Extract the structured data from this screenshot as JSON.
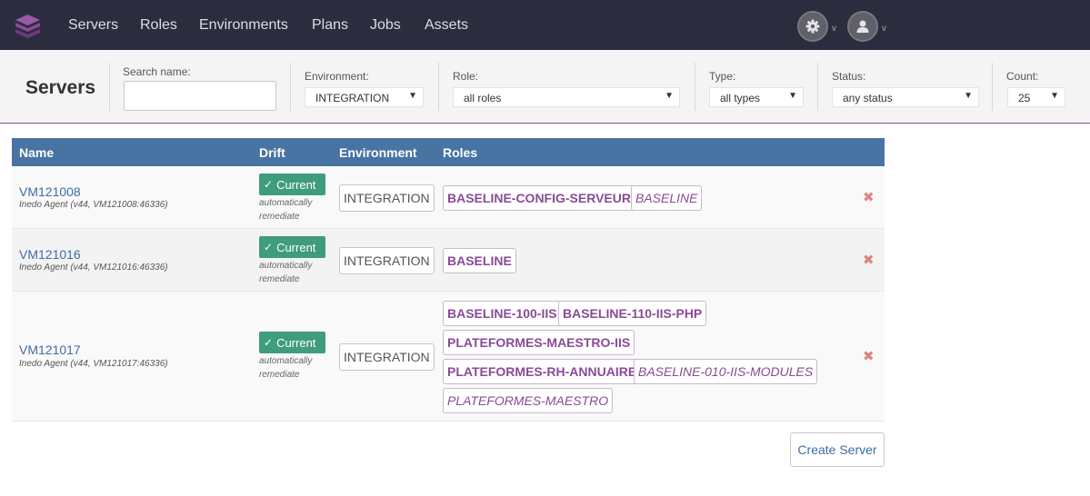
{
  "nav": {
    "items": [
      "Servers",
      "Roles",
      "Environments",
      "Plans",
      "Jobs",
      "Assets"
    ],
    "settings_icon": "gear-icon",
    "user_icon": "user-icon",
    "caret": "v",
    "brand_color": "#7f4a8a",
    "bg_color": "#2b2d3e"
  },
  "filters": {
    "title": "Servers",
    "search_label": "Search name:",
    "search_value": "",
    "environment_label": "Environment:",
    "environment_value": "INTEGRATION",
    "role_label": "Role:",
    "role_value": "all roles",
    "type_label": "Type:",
    "type_value": "all types",
    "status_label": "Status:",
    "status_value": "any status",
    "count_label": "Count:",
    "count_value": "25",
    "arrow": "▼"
  },
  "table": {
    "headers": [
      "Name",
      "Drift",
      "Environment",
      "Roles"
    ],
    "header_color": "#4874a4",
    "rows": [
      {
        "name": "VM121008",
        "agent": "Inedo Agent (v44, VM121008:46336)",
        "drift": "Current",
        "drift_note_1": "automatically",
        "drift_note_2": "remediate",
        "environment": "INTEGRATION",
        "roles": [
          "BASELINE-CONFIG-SERVEURS",
          "BASELINE"
        ]
      },
      {
        "name": "VM121016",
        "agent": "Inedo Agent (v44, VM121016:46336)",
        "drift": "Current",
        "drift_note_1": "automatically",
        "drift_note_2": "remediate",
        "environment": "INTEGRATION",
        "roles": [
          "BASELINE"
        ]
      },
      {
        "name": "VM121017",
        "agent": "Inedo Agent (v44, VM121017:46336)",
        "drift": "Current",
        "drift_note_1": "automatically",
        "drift_note_2": "remediate",
        "environment": "INTEGRATION",
        "roles": [
          "BASELINE-100-IIS",
          "BASELINE-110-IIS-PHP",
          "PLATEFORMES-MAESTRO-IIS",
          "PLATEFORMES-RH-ANNUAIRE",
          "BASELINE-010-IIS-MODULES",
          "PLATEFORMES-MAESTRO"
        ]
      }
    ],
    "delete_symbol": "✖",
    "check_symbol": "✓",
    "drift_color": "#3f9c7e",
    "role_color": "#8a4a96"
  },
  "actions": {
    "create_server": "Create Server"
  }
}
